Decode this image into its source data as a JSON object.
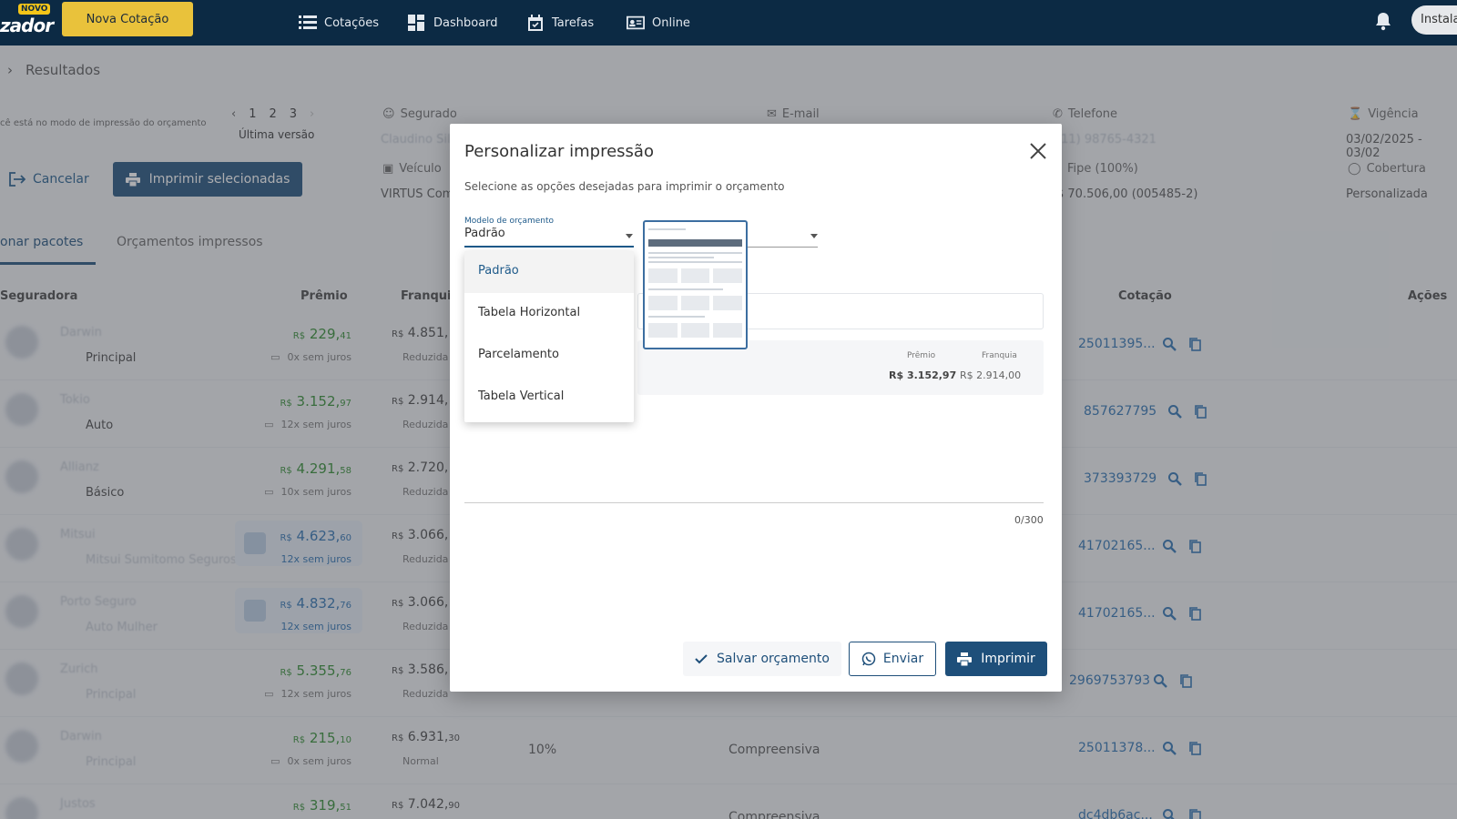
{
  "topbar": {
    "logo_badge": "NOVO",
    "logo_text": "zador",
    "new_quote": "Nova Cotação",
    "nav": [
      {
        "label": "Cotações",
        "icon": "list-icon"
      },
      {
        "label": "Dashboard",
        "icon": "dashboard-icon"
      },
      {
        "label": "Tarefas",
        "icon": "calendar-check-icon"
      },
      {
        "label": "Online",
        "icon": "id-card-icon"
      }
    ],
    "install_label": "Instala"
  },
  "breadcrumb": {
    "current": "Resultados"
  },
  "print_mode": {
    "note": "cê está no modo de impressão do orçamento",
    "pages": [
      "1",
      "2",
      "3"
    ],
    "version_label": "Última versão",
    "cancel_label": "Cancelar",
    "print_selected_label": "Imprimir selecionadas"
  },
  "summary": {
    "segurado_label": "Segurado",
    "segurado_value": "Claudino Sil",
    "veiculo_label": "Veículo",
    "veiculo_value": "VIRTUS Com",
    "email_label": "E-mail",
    "telefone_label": "Telefone",
    "telefone_value": "(11) 98765-4321",
    "fipe_label": "Fipe (100%)",
    "fipe_value": "$ 70.506,00 (005485-2)",
    "vigencia_label": "Vigência",
    "vigencia_value": "03/02/2025 - 03/02",
    "cobertura_label": "Cobertura",
    "cobertura_value": "Personalizada"
  },
  "tabs": [
    "onar pacotes",
    "Orçamentos impressos"
  ],
  "table": {
    "headers": {
      "seguradora": "Seguradora",
      "premio": "Prêmio",
      "franquia": "Franquia",
      "cotacao": "Cotação",
      "acoes": "Ações"
    },
    "rows": [
      {
        "insurer": "Darwin",
        "plan": "Principal",
        "plan_blur": false,
        "premio_main": "229,",
        "premio_cents": "41",
        "premio_sub": "0x sem juros",
        "highlight": false,
        "franq_main": "4.851,",
        "franq_cents": "",
        "franq_sub": "Reduzida",
        "pct": "",
        "cob": "",
        "cotacao": "25011395..."
      },
      {
        "insurer": "Tokio",
        "plan": "Auto",
        "plan_blur": false,
        "premio_main": "3.152,",
        "premio_cents": "97",
        "premio_sub": "12x sem juros",
        "highlight": false,
        "franq_main": "2.914,",
        "franq_cents": "",
        "franq_sub": "Reduzida",
        "pct": "",
        "cob": "",
        "cotacao": "857627795"
      },
      {
        "insurer": "Allianz",
        "plan": "Básico",
        "plan_blur": false,
        "premio_main": "4.291,",
        "premio_cents": "58",
        "premio_sub": "10x sem juros",
        "highlight": false,
        "franq_main": "2.720,",
        "franq_cents": "",
        "franq_sub": "Reduzida",
        "pct": "",
        "cob": "",
        "cotacao": "373393729"
      },
      {
        "insurer": "Mitsui",
        "plan": "Mitsui Sumitomo Seguros",
        "plan_blur": true,
        "premio_main": "4.623,",
        "premio_cents": "60",
        "premio_sub": "12x sem juros",
        "highlight": true,
        "franq_main": "3.066,",
        "franq_cents": "",
        "franq_sub": "Reduzida",
        "pct": "",
        "cob": "",
        "cotacao": "41702165..."
      },
      {
        "insurer": "Porto Seguro",
        "plan": "Auto Mulher",
        "plan_blur": true,
        "premio_main": "4.832,",
        "premio_cents": "76",
        "premio_sub": "12x sem juros",
        "highlight": true,
        "franq_main": "3.066,",
        "franq_cents": "",
        "franq_sub": "Reduzida",
        "pct": "",
        "cob": "",
        "cotacao": "41702165..."
      },
      {
        "insurer": "Zurich",
        "plan": "Principal",
        "plan_blur": true,
        "premio_main": "5.355,",
        "premio_cents": "76",
        "premio_sub": "12x sem juros",
        "highlight": false,
        "franq_main": "3.586,",
        "franq_cents": "",
        "franq_sub": "Reduzida",
        "pct": "",
        "cob": "",
        "cotacao": "2969753793"
      },
      {
        "insurer": "Darwin",
        "plan": "Principal",
        "plan_blur": true,
        "premio_main": "215,",
        "premio_cents": "10",
        "premio_sub": "0x sem juros",
        "highlight": false,
        "franq_main": "6.931,",
        "franq_cents": "30",
        "franq_sub": "Normal",
        "pct": "10%",
        "cob": "Compreensiva",
        "cotacao": "25011378..."
      },
      {
        "insurer": "Justos",
        "plan": "",
        "plan_blur": true,
        "premio_main": "319,",
        "premio_cents": "51",
        "premio_sub": "",
        "highlight": false,
        "franq_main": "7.042,",
        "franq_cents": "90",
        "franq_sub": "",
        "pct": "",
        "cob": "Compreensiva",
        "cotacao": "dc4db6ac..."
      }
    ],
    "currency": "R$"
  },
  "modal": {
    "title": "Personalizar impressão",
    "description": "Selecione as opções desejadas para imprimir o orçamento",
    "select_label": "Modelo de orçamento",
    "select_value": "Padrão",
    "options": [
      "Padrão",
      "Tabela Horizontal",
      "Parcelamento",
      "Tabela Vertical"
    ],
    "package": {
      "premio_label": "Prêmio",
      "premio_value": "R$ 3.152,97",
      "franquia_label": "Franquia",
      "franquia_value": "R$ 2.914,00"
    },
    "counter": "0/300",
    "save_label": "Salvar orçamento",
    "send_label": "Enviar",
    "print_label": "Imprimir"
  },
  "colors": {
    "nav_bg": "#0c2a44",
    "accent_yellow": "#e9c23b",
    "primary": "#1e4f7a",
    "price_green": "#2e8b2e",
    "link_blue": "#2a6fb0"
  }
}
